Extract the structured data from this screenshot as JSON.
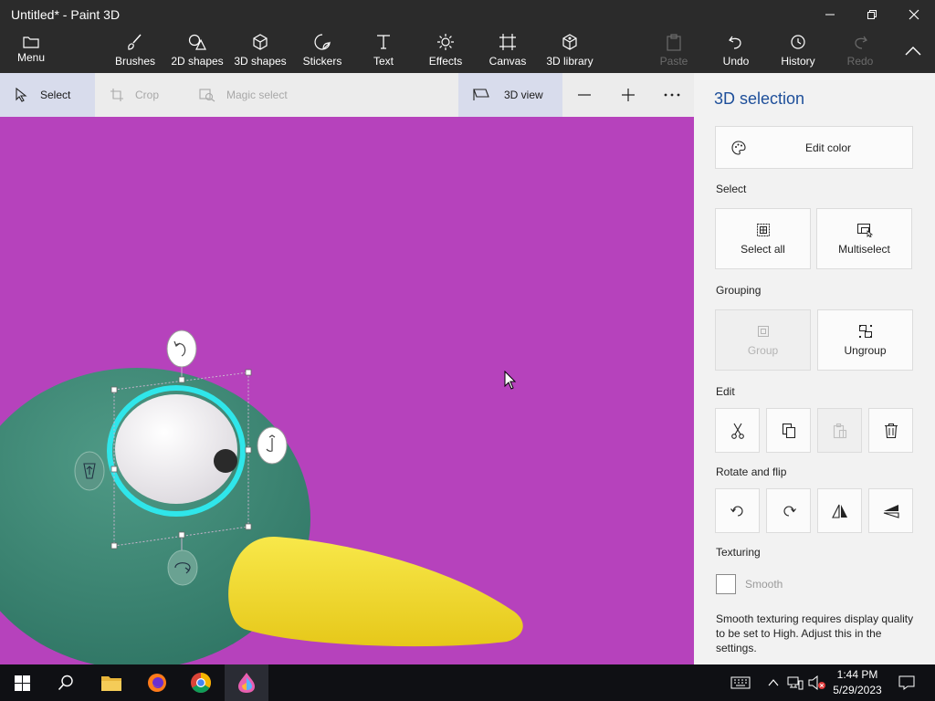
{
  "window": {
    "title": "Untitled* - Paint 3D"
  },
  "ribbon": {
    "menu": "Menu",
    "brushes": "Brushes",
    "shapes2d": "2D shapes",
    "shapes3d": "3D shapes",
    "stickers": "Stickers",
    "text": "Text",
    "effects": "Effects",
    "canvas": "Canvas",
    "library3d": "3D library",
    "paste": "Paste",
    "undo": "Undo",
    "history": "History",
    "redo": "Redo"
  },
  "toolbar": {
    "select": "Select",
    "crop": "Crop",
    "magic_select": "Magic select",
    "view3d": "3D view"
  },
  "panel": {
    "title": "3D selection",
    "edit_color": "Edit color",
    "select_label": "Select",
    "select_all": "Select all",
    "multiselect": "Multiselect",
    "grouping_label": "Grouping",
    "group": "Group",
    "ungroup": "Ungroup",
    "edit_label": "Edit",
    "rotate_label": "Rotate and flip",
    "texturing_label": "Texturing",
    "smooth": "Smooth",
    "smooth_note": "Smooth texturing requires display quality to be set to High. Adjust this in the settings."
  },
  "taskbar": {
    "time": "1:44 PM",
    "date": "5/29/2023"
  },
  "colors": {
    "canvas": "#b642bc",
    "bird_body": "#3f8a78",
    "beak": "#f2de2a",
    "selection_ring": "#2fe6ea",
    "accent": "#1e4f9a"
  }
}
